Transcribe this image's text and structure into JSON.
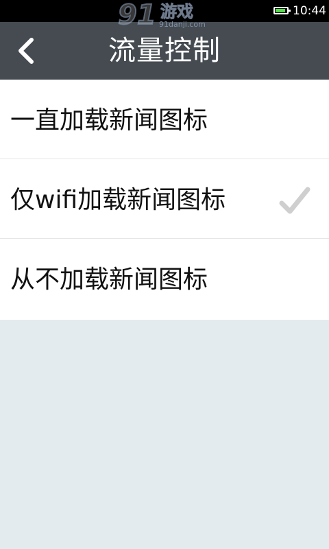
{
  "status_bar": {
    "time": "10:44",
    "battery_level": 0.9,
    "battery_color": "#55e04a"
  },
  "watermark": {
    "logo_number": "91",
    "logo_text": "游戏",
    "url": "91danji.com"
  },
  "header": {
    "title": "流量控制",
    "back_icon": "chevron-left-icon",
    "background_color": "#454b51"
  },
  "options": [
    {
      "label": "一直加载新闻图标",
      "selected": false
    },
    {
      "label": "仅wifi加载新闻图标",
      "selected": true
    },
    {
      "label": "从不加载新闻图标",
      "selected": false
    }
  ],
  "selected_indicator_icon": "checkmark-icon"
}
